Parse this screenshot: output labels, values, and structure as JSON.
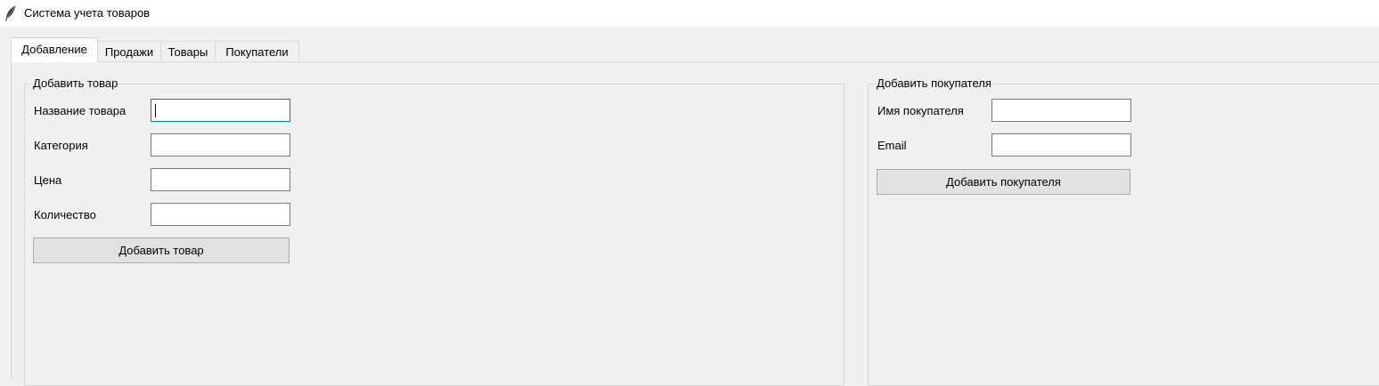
{
  "window": {
    "title": "Система учета товаров",
    "icon": "feather-icon"
  },
  "tabs": [
    {
      "label": "Добавление",
      "active": true
    },
    {
      "label": "Продажи",
      "active": false
    },
    {
      "label": "Товары",
      "active": false
    },
    {
      "label": "Покупатели",
      "active": false
    }
  ],
  "add_product": {
    "title": "Добавить товар",
    "fields": [
      {
        "label": "Название товара",
        "value": ""
      },
      {
        "label": "Категория",
        "value": ""
      },
      {
        "label": "Цена",
        "value": ""
      },
      {
        "label": "Количество",
        "value": ""
      }
    ],
    "button_label": "Добавить товар"
  },
  "add_customer": {
    "title": "Добавить покупателя",
    "fields": [
      {
        "label": "Имя покупателя",
        "value": ""
      },
      {
        "label": "Email",
        "value": ""
      }
    ],
    "button_label": "Добавить покупателя"
  }
}
